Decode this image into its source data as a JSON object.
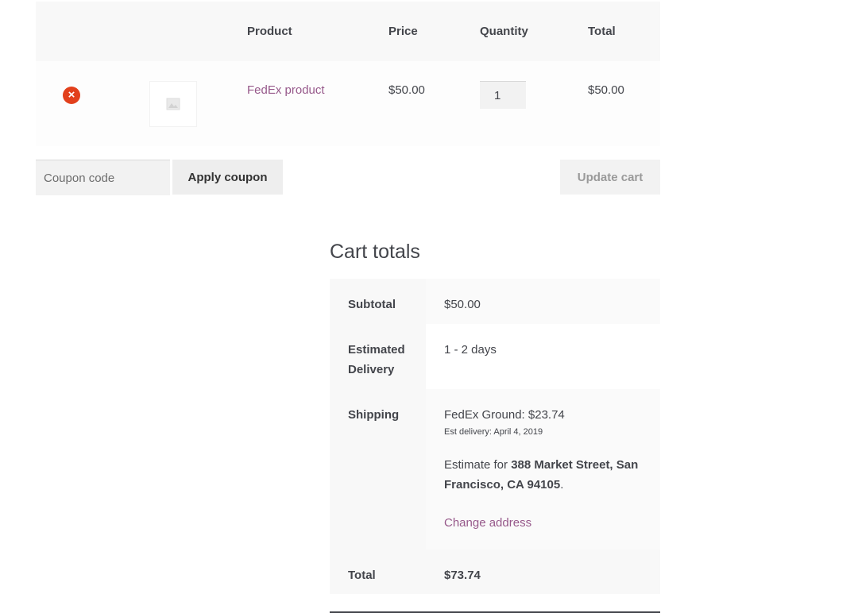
{
  "cart": {
    "headers": {
      "product": "Product",
      "price": "Price",
      "quantity": "Quantity",
      "total": "Total"
    },
    "items": [
      {
        "remove_icon": "×",
        "name": "FedEx product",
        "price": "$50.00",
        "quantity": "1",
        "total": "$50.00"
      }
    ]
  },
  "actions": {
    "coupon_placeholder": "Coupon code",
    "apply_label": "Apply coupon",
    "update_label": "Update cart"
  },
  "totals": {
    "title": "Cart totals",
    "subtotal_label": "Subtotal",
    "subtotal_value": "$50.00",
    "delivery_label": "Estimated Delivery",
    "delivery_value": "1 - 2 days",
    "shipping_label": "Shipping",
    "shipping_method": "FedEx Ground: $23.74",
    "shipping_note": "Est delivery: April 4, 2019",
    "estimate_prefix": "Estimate for ",
    "estimate_address": "388 Market Street, San Francisco, CA 94105",
    "estimate_suffix": ".",
    "change_address": "Change address",
    "total_label": "Total",
    "total_value": "$73.74"
  },
  "colors": {
    "link": "#96588a",
    "remove": "#e2401c"
  }
}
